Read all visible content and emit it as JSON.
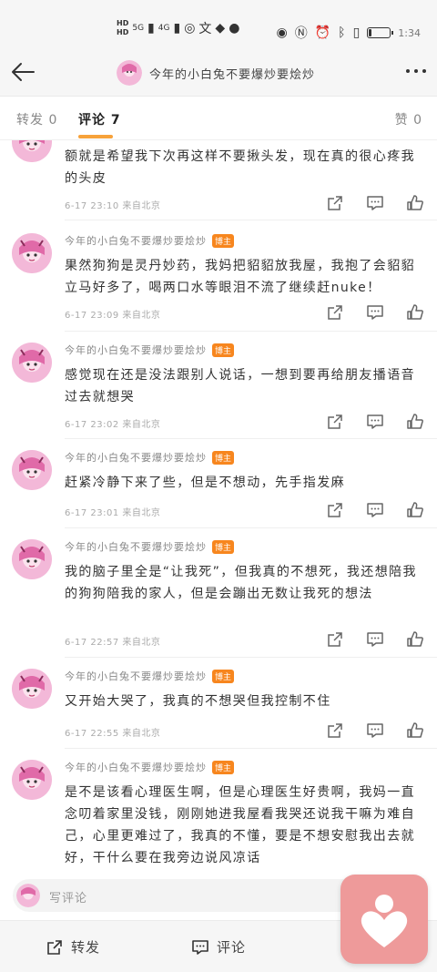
{
  "status_bar": {
    "sim1": "HD",
    "sim2": "HD",
    "network1": "5G",
    "network2": "4G",
    "icons": [
      "wechat-icon",
      "text-icon",
      "app-icon",
      "qq-icon",
      "eye-icon",
      "nfc-icon",
      "alarm-icon",
      "bluetooth-icon",
      "vibrate-icon"
    ],
    "battery_level": 0.1,
    "time": "1:34"
  },
  "header": {
    "title": "今年的小白兔不要爆炒要烩炒"
  },
  "tabs": {
    "repost": "转发 0",
    "comment": "评论 7",
    "like": "赞 0"
  },
  "comments": [
    {
      "name": "",
      "badge": "",
      "text": "额就是希望我下次再这样不要揪头发，现在真的很心疼我的头皮",
      "meta": "6-17 23:10  来自北京"
    },
    {
      "name": "今年的小白兔不要爆炒要烩炒",
      "badge": "博主",
      "text": "果然狗狗是灵丹妙药，我妈把貂貂放我屋，我抱了会貂貂立马好多了，喝两口水等眼泪不流了继续赶nuke！",
      "meta": "6-17 23:09  来自北京"
    },
    {
      "name": "今年的小白兔不要爆炒要烩炒",
      "badge": "博主",
      "text": "感觉现在还是没法跟别人说话，一想到要再给朋友播语音过去就想哭",
      "meta": "6-17 23:02  来自北京"
    },
    {
      "name": "今年的小白兔不要爆炒要烩炒",
      "badge": "博主",
      "text": "赶紧冷静下来了些，但是不想动，先手指发麻",
      "meta": "6-17 23:01  来自北京"
    },
    {
      "name": "今年的小白兔不要爆炒要烩炒",
      "badge": "博主",
      "text": "我的脑子里全是“让我死”，但我真的不想死，我还想陪我的狗狗陪我的家人，但是会蹦出无数让我死的想法",
      "meta": "6-17 22:57  来自北京"
    },
    {
      "name": "今年的小白兔不要爆炒要烩炒",
      "badge": "博主",
      "text": "又开始大哭了，我真的不想哭但我控制不住",
      "meta": "6-17 22:55  来自北京"
    },
    {
      "name": "今年的小白兔不要爆炒要烩炒",
      "badge": "博主",
      "text": "是不是该看心理医生啊，但是心理医生好贵啊，我妈一直念叨着家里没钱，刚刚她进我屋看我哭还说我干嘛为难自己，心里更难过了，我真的不懂，要是不想安慰我出去就好，干什么要在我旁边说风凉话",
      "meta": ""
    }
  ],
  "write_bar": {
    "placeholder": "写评论"
  },
  "bottom_bar": {
    "repost": "转发",
    "comment": "评论"
  },
  "colors": {
    "accent": "#f7a23a",
    "badge": "#f7861e",
    "float_button": "#ee9a9a",
    "avatar_pink": "#f3b8d8"
  }
}
